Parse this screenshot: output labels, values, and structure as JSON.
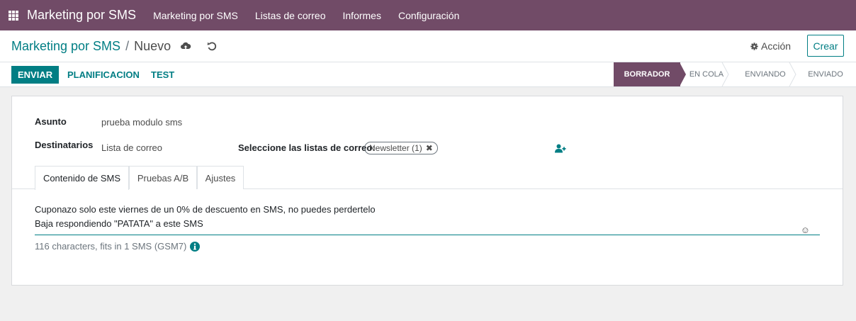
{
  "topnav": {
    "brand": "Marketing por SMS",
    "menu": [
      "Marketing por SMS",
      "Listas de correo",
      "Informes",
      "Configuración"
    ]
  },
  "breadcrumb": {
    "parent": "Marketing por SMS",
    "separator": "/",
    "current": "Nuevo"
  },
  "control": {
    "action_label": "Acción",
    "create_label": "Crear"
  },
  "statusbar": {
    "send_label": "ENVIAR",
    "schedule_label": "PLANIFICACION",
    "test_label": "TEST",
    "stages": [
      "BORRADOR",
      "EN COLA",
      "ENVIANDO",
      "ENVIADO"
    ],
    "active_stage": "BORRADOR"
  },
  "form": {
    "subject_label": "Asunto",
    "subject_value": "prueba modulo sms",
    "recipients_label": "Destinatarios",
    "recipients_value": "Lista de correo",
    "lists_label": "Seleccione las listas de correo:",
    "lists_tag": "Newsletter (1)"
  },
  "tabs": [
    "Contenido de SMS",
    "Pruebas A/B",
    "Ajustes"
  ],
  "sms": {
    "line1": "Cuponazo solo este viernes de un 0% de descuento en SMS, no puedes perdertelo",
    "line2": "Baja respondiendo \"PATATA\" a este SMS",
    "counter": "116 characters, fits in 1 SMS (GSM7)"
  },
  "colors": {
    "brand": "#714b67",
    "accent": "#017e84"
  },
  "icons": [
    "apps-grid-icon",
    "cloud-upload-icon",
    "undo-icon",
    "gear-icon",
    "add-user-icon",
    "close-icon",
    "emoji-icon",
    "info-icon"
  ]
}
